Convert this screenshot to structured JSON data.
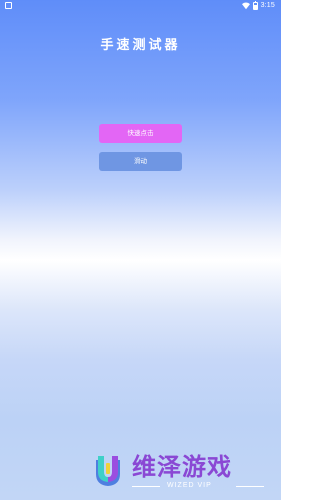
{
  "status_bar": {
    "time": "3:15",
    "icons": [
      "app-notification-icon",
      "wifi-icon",
      "battery-icon"
    ]
  },
  "app": {
    "title": "手速测试器"
  },
  "buttons": {
    "tap_label": "快速点击",
    "swipe_label": "滑动"
  },
  "watermark": {
    "name": "维泽游戏",
    "subtitle": "WIZED VIP"
  },
  "colors": {
    "tap_button": "#e366f5",
    "swipe_button": "#6f96e3",
    "watermark_text": "#8a48d4",
    "background_top": "#5f8df9",
    "background_bottom": "#c2d6f6"
  }
}
